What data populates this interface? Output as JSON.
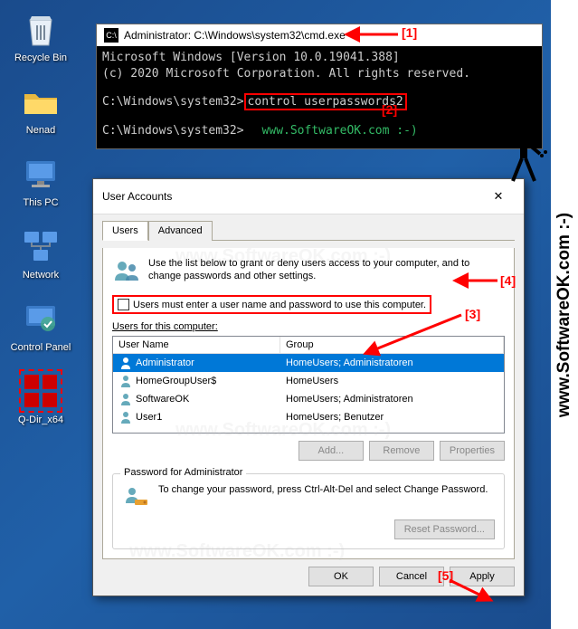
{
  "desktop": {
    "icons": [
      {
        "label": "Recycle Bin"
      },
      {
        "label": "Nenad"
      },
      {
        "label": "This PC"
      },
      {
        "label": "Network"
      },
      {
        "label": "Control Panel"
      },
      {
        "label": "Q-Dir_x64"
      }
    ]
  },
  "cmd": {
    "title": "Administrator: C:\\Windows\\system32\\cmd.exe",
    "line1": "Microsoft Windows [Version 10.0.19041.388]",
    "line2": "(c) 2020 Microsoft Corporation. All rights reserved.",
    "prompt1": "C:\\Windows\\system32>",
    "command": "control userpasswords2",
    "prompt2": "C:\\Windows\\system32>",
    "watermark": "www.SoftwareOK.com :-)"
  },
  "ua": {
    "title": "User Accounts",
    "tabs": {
      "users": "Users",
      "advanced": "Advanced"
    },
    "intro": "Use the list below to grant or deny users access to your computer, and to change passwords and other settings.",
    "checkbox_label": "Users must enter a user name and password to use this computer.",
    "users_label": "Users for this computer:",
    "columns": {
      "name": "User Name",
      "group": "Group"
    },
    "rows": [
      {
        "name": "Administrator",
        "group": "HomeUsers; Administratoren",
        "selected": true
      },
      {
        "name": "HomeGroupUser$",
        "group": "HomeUsers"
      },
      {
        "name": "SoftwareOK",
        "group": "HomeUsers; Administratoren"
      },
      {
        "name": "User1",
        "group": "HomeUsers; Benutzer"
      }
    ],
    "buttons": {
      "add": "Add...",
      "remove": "Remove",
      "properties": "Properties"
    },
    "pw_group": {
      "legend": "Password for Administrator",
      "text": "To change your password, press Ctrl-Alt-Del and select Change Password.",
      "reset": "Reset Password..."
    },
    "dialog_buttons": {
      "ok": "OK",
      "cancel": "Cancel",
      "apply": "Apply"
    }
  },
  "annotations": {
    "a1": "[1]",
    "a2": "[2]",
    "a3": "[3]",
    "a4": "[4]",
    "a5": "[5]"
  },
  "watermarks": {
    "wm": "www.SoftwareOK.com :-)",
    "side": "www.SoftwareOK.com :-)"
  }
}
